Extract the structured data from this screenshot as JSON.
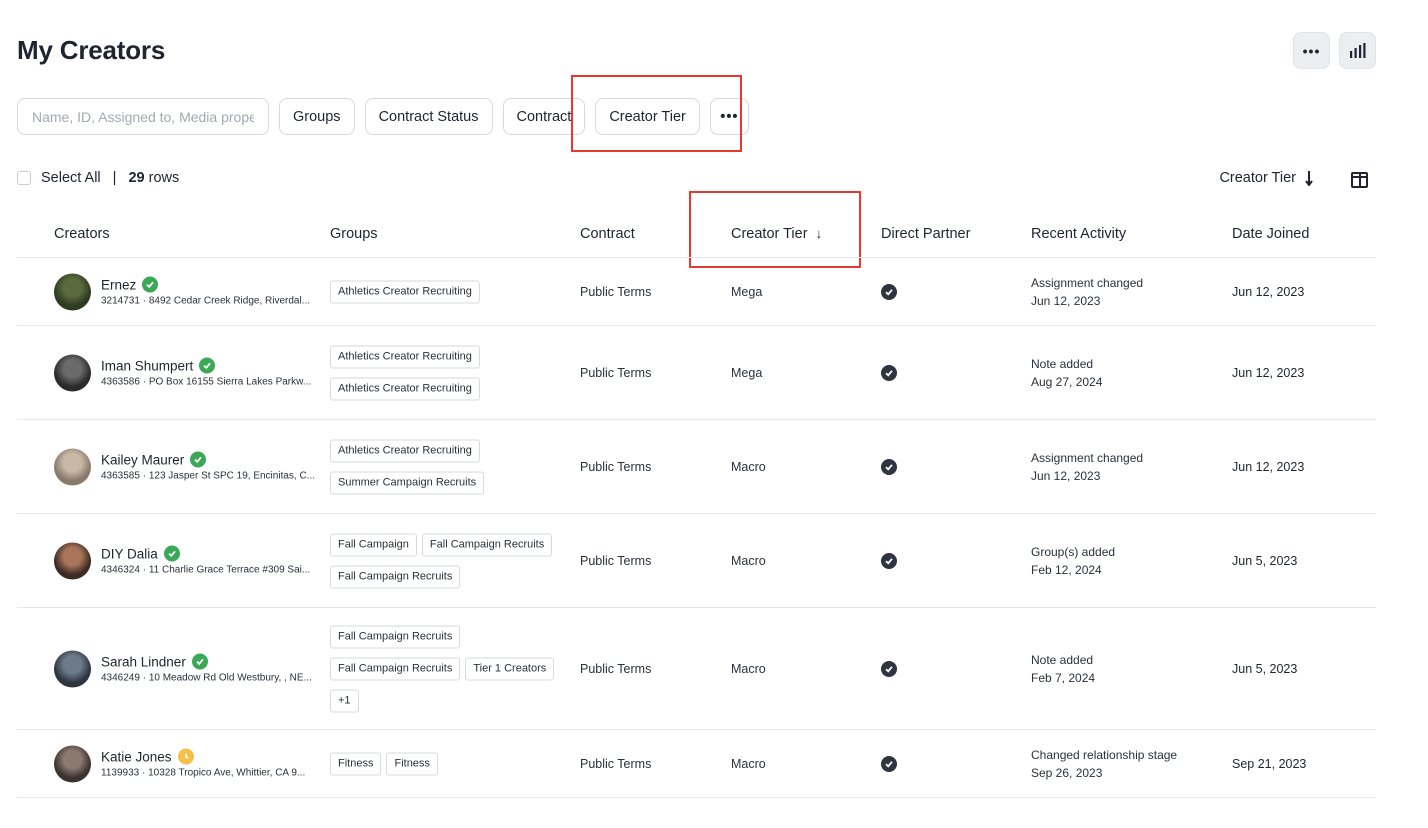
{
  "header": {
    "title": "My Creators"
  },
  "filters": {
    "search_placeholder": "Name, ID, Assigned to, Media prope",
    "chips": [
      "Groups",
      "Contract Status",
      "Contract",
      "Creator Tier"
    ],
    "more_label": "•••"
  },
  "toolbar": {
    "select_all_label": "Select All",
    "separator": "|",
    "rows_count": "29",
    "rows_suffix": "rows",
    "sort_label": "Creator Tier"
  },
  "table": {
    "columns": [
      "Creators",
      "Groups",
      "Contract",
      "Creator Tier",
      "Direct Partner",
      "Recent Activity",
      "Date Joined"
    ],
    "sorted_column_arrow": "↓",
    "rows": [
      {
        "name": "Ernez",
        "status": "verified",
        "id": "3214731",
        "address": "8492 Cedar Creek Ridge, Riverdal...",
        "groups": [
          [
            "Athletics Creator Recruiting"
          ]
        ],
        "contract": "Public Terms",
        "tier": "Mega",
        "direct_partner": true,
        "activity": "Assignment changed",
        "activity_date": "Jun 12, 2023",
        "date_joined": "Jun 12, 2023"
      },
      {
        "name": "Iman Shumpert",
        "status": "verified",
        "id": "4363586",
        "address": "PO Box 16155 Sierra Lakes Parkw...",
        "groups": [
          [
            "Athletics Creator Recruiting"
          ],
          [
            "Athletics Creator Recruiting"
          ]
        ],
        "contract": "Public Terms",
        "tier": "Mega",
        "direct_partner": true,
        "activity": "Note added",
        "activity_date": "Aug 27, 2024",
        "date_joined": "Jun 12, 2023"
      },
      {
        "name": "Kailey Maurer",
        "status": "verified",
        "id": "4363585",
        "address": "123 Jasper St SPC 19, Encinitas, C...",
        "groups": [
          [
            "Athletics Creator Recruiting"
          ],
          [
            "Summer Campaign Recruits"
          ]
        ],
        "contract": "Public Terms",
        "tier": "Macro",
        "direct_partner": true,
        "activity": "Assignment changed",
        "activity_date": "Jun 12, 2023",
        "date_joined": "Jun 12, 2023"
      },
      {
        "name": "DIY Dalia",
        "status": "verified",
        "id": "4346324",
        "address": "11 Charlie Grace Terrace #309 Sai...",
        "groups": [
          [
            "Fall Campaign",
            "Fall Campaign Recruits"
          ],
          [
            "Fall Campaign Recruits"
          ]
        ],
        "contract": "Public Terms",
        "tier": "Macro",
        "direct_partner": true,
        "activity": "Group(s) added",
        "activity_date": "Feb 12, 2024",
        "date_joined": "Jun 5, 2023"
      },
      {
        "name": "Sarah Lindner",
        "status": "verified",
        "id": "4346249",
        "address": "10 Meadow Rd Old Westbury, , NE...",
        "groups": [
          [
            "Fall Campaign Recruits"
          ],
          [
            "Fall Campaign Recruits",
            "Tier 1 Creators"
          ],
          [
            "+1"
          ]
        ],
        "contract": "Public Terms",
        "tier": "Macro",
        "direct_partner": true,
        "activity": "Note added",
        "activity_date": "Feb 7, 2024",
        "date_joined": "Jun 5, 2023"
      },
      {
        "name": "Katie Jones",
        "status": "pending",
        "id": "1139933",
        "address": "10328 Tropico Ave, Whittier, CA 9...",
        "groups": [
          [
            "Fitness",
            "Fitness"
          ]
        ],
        "contract": "Public Terms",
        "tier": "Macro",
        "direct_partner": true,
        "activity": "Changed relationship stage",
        "activity_date": "Sep 26, 2023",
        "date_joined": "Sep 21, 2023"
      }
    ]
  },
  "colors": {
    "text": "#1f2430",
    "border": "#d7d9de",
    "verified": "#3aa856",
    "pending": "#f5c04a",
    "partner_check": "#2e3440",
    "highlight": "#e53a2f"
  },
  "icons": {
    "more": "more-horizontal-icon",
    "chart": "bar-chart-icon",
    "sort": "arrow-down-icon",
    "columns": "columns-layout-icon",
    "verified": "check-circle-icon",
    "pending": "clock-icon",
    "direct_partner": "check-circle-filled-icon"
  }
}
